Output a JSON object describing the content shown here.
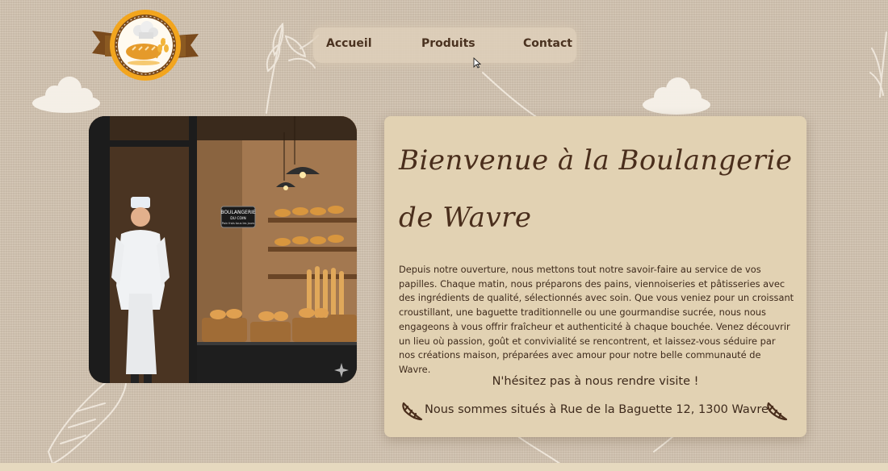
{
  "nav": {
    "items": [
      {
        "label": "Accueil"
      },
      {
        "label": "Produits"
      },
      {
        "label": "Contact"
      }
    ]
  },
  "photo": {
    "sign": {
      "line1": "BOULANGERIE",
      "line2": "DU COIN",
      "line3": "Pain frais tous les jours"
    }
  },
  "welcome": {
    "title": "Bienvenue à la Boulangerie de Wavre",
    "body": "Depuis notre ouverture, nous mettons tout notre savoir-faire au service de vos papilles. Chaque matin, nous préparons des pains, viennoiseries et pâtisseries avec des ingrédients de qualité, sélectionnés avec soin. Que vous veniez pour un croissant croustillant, une baguette traditionnelle ou une gourmandise sucrée, nous nous engageons à vous offrir fraîcheur et authenticité à chaque bouchée. Venez découvrir un lieu où passion, goût et convivialité se rencontrent, et laissez-vous séduire par nos créations maison, préparées avec amour pour notre belle communauté de Wavre.",
    "invite": "N'hésitez pas à nous rendre visite !",
    "address": "Nous sommes situés à Rue de la Baguette 12, 1300 Wavre"
  },
  "colors": {
    "background": "#d3c4b1",
    "card": "#e2d2b3",
    "text": "#3e2a1c",
    "title": "#4a2e1c",
    "logo_ring": "#f2a51e",
    "logo_ribbon": "#8b5a22"
  },
  "icons": {
    "croissant": "croissant-icon",
    "logo": "bakery-logo"
  }
}
